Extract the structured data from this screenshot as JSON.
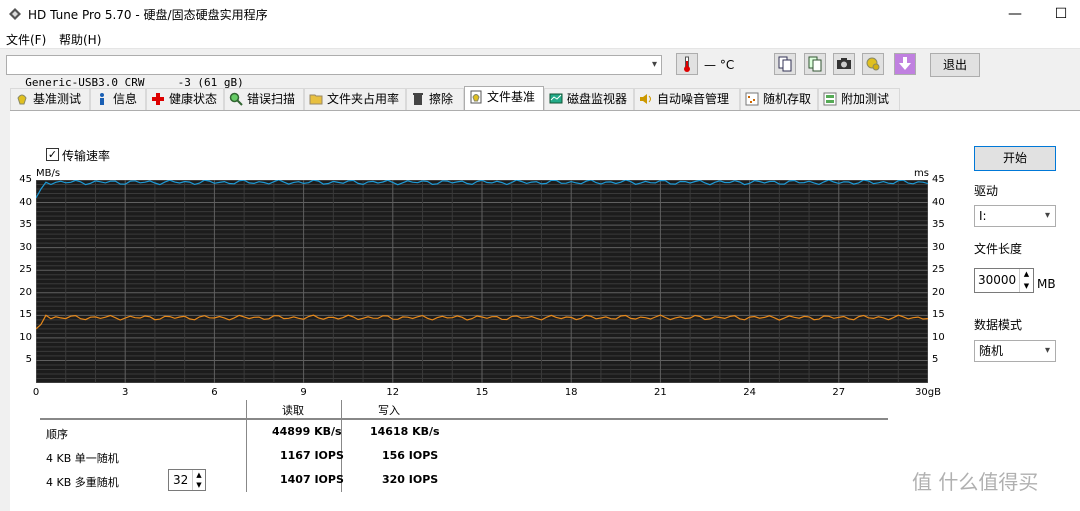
{
  "window": {
    "title": "HD Tune Pro 5.70 - 硬盘/固态硬盘实用程序",
    "minimize": "—",
    "maximize": "☐",
    "close": "✕"
  },
  "menu": [
    "文件(F)",
    "帮助(H)"
  ],
  "drive": {
    "selected": "Generic-USB3.0 CRW     -3 (61 gB)"
  },
  "temperature": "— °C",
  "exit_label": "退出",
  "tabs": [
    {
      "label": "基准测试",
      "icon": "benchmark-icon"
    },
    {
      "label": "信息",
      "icon": "info-icon"
    },
    {
      "label": "健康状态",
      "icon": "health-cross-icon"
    },
    {
      "label": "错误扫描",
      "icon": "magnifier-icon"
    },
    {
      "label": "文件夹占用率",
      "icon": "folder-icon"
    },
    {
      "label": "擦除",
      "icon": "trash-icon"
    },
    {
      "label": "文件基准",
      "icon": "file-benchmark-icon",
      "active": true
    },
    {
      "label": "磁盘监视器",
      "icon": "monitor-icon"
    },
    {
      "label": "自动噪音管理",
      "icon": "speaker-icon"
    },
    {
      "label": "随机存取",
      "icon": "random-access-icon"
    },
    {
      "label": "附加测试",
      "icon": "extra-tests-icon"
    }
  ],
  "options": {
    "transfer_rate_label": "传输速率",
    "transfer_rate_checked": true
  },
  "chart_data": {
    "type": "line",
    "y_left_unit": "MB/s",
    "y_right_unit": "ms",
    "y_ticks": [
      "45",
      "40",
      "35",
      "30",
      "25",
      "20",
      "15",
      "10",
      "5"
    ],
    "x_ticks": [
      "0",
      "3",
      "6",
      "9",
      "12",
      "15",
      "18",
      "21",
      "24",
      "27",
      "30gB"
    ],
    "xlim": [
      0,
      30
    ],
    "ylim": [
      0,
      45
    ],
    "grid": true,
    "series": [
      {
        "color": "#1e9ad6",
        "approx_value": 44.5,
        "start_values": [
          41.0,
          43.0,
          44.5
        ]
      },
      {
        "color": "#e8891a",
        "approx_value": 14.5,
        "start_values": [
          12.0,
          13.0,
          15.0
        ]
      }
    ]
  },
  "results": {
    "col_read": "读取",
    "col_write": "写入",
    "rows": [
      {
        "label": "顺序",
        "read": "44899 KB/s",
        "write": "14618 KB/s"
      },
      {
        "label": "4 KB 单一随机",
        "read": "1167 IOPS",
        "write": "156 IOPS"
      },
      {
        "label": "4 KB 多重随机",
        "read": "1407 IOPS",
        "write": "320 IOPS"
      }
    ],
    "queue_depth": "32"
  },
  "sidebar": {
    "start_label": "开始",
    "drive_label": "驱动",
    "drive_value": "I:",
    "file_length_label": "文件长度",
    "file_length_value": "30000",
    "file_length_unit": "MB",
    "data_mode_label": "数据模式",
    "data_mode_value": "随机"
  },
  "watermark": "值 什么值得买"
}
